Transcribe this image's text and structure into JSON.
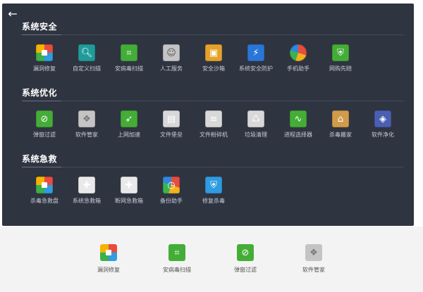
{
  "window": {
    "back_label": "←"
  },
  "sections": [
    {
      "title": "系统安全",
      "items": [
        {
          "label": "漏洞修复",
          "icon": "shield-grid-icon"
        },
        {
          "label": "自定义扫描",
          "icon": "magnifier-scan-icon"
        },
        {
          "label": "安病毒扫描",
          "icon": "scan-frame-icon"
        },
        {
          "label": "人工服务",
          "icon": "service-person-icon"
        },
        {
          "label": "安全沙箱",
          "icon": "sandbox-icon"
        },
        {
          "label": "系统安全防护",
          "icon": "lightning-shield-icon"
        },
        {
          "label": "手机助手",
          "icon": "phone-assistant-icon"
        },
        {
          "label": "网购先赔",
          "icon": "shopping-shield-icon"
        }
      ]
    },
    {
      "title": "系统优化",
      "items": [
        {
          "label": "弹窗过滤",
          "icon": "popup-block-icon"
        },
        {
          "label": "软件管家",
          "icon": "software-manager-icon"
        },
        {
          "label": "上网加速",
          "icon": "rocket-icon"
        },
        {
          "label": "文件堡垒",
          "icon": "file-fortress-icon"
        },
        {
          "label": "文件粉碎机",
          "icon": "shredder-icon"
        },
        {
          "label": "垃圾清理",
          "icon": "cleanup-icon"
        },
        {
          "label": "进程选择器",
          "icon": "process-monitor-icon"
        },
        {
          "label": "杀毒搬家",
          "icon": "house-move-icon"
        },
        {
          "label": "软件净化",
          "icon": "layers-icon"
        }
      ]
    },
    {
      "title": "系统急救",
      "items": [
        {
          "label": "杀毒急救盘",
          "icon": "rescue-disk-icon"
        },
        {
          "label": "系统急救箱",
          "icon": "first-aid-box-icon"
        },
        {
          "label": "断网急救箱",
          "icon": "network-aid-icon"
        },
        {
          "label": "备份助手",
          "icon": "backup-clock-icon"
        },
        {
          "label": "修复杀毒",
          "icon": "repair-shield-icon"
        }
      ]
    }
  ],
  "pinned": [
    {
      "label": "漏洞修复",
      "icon": "shield-grid-icon"
    },
    {
      "label": "安病毒扫描",
      "icon": "scan-frame-icon"
    },
    {
      "label": "弹窗过滤",
      "icon": "popup-block-icon"
    },
    {
      "label": "软件管家",
      "icon": "software-manager-icon"
    }
  ],
  "background_fragment": {
    "text": ""
  }
}
